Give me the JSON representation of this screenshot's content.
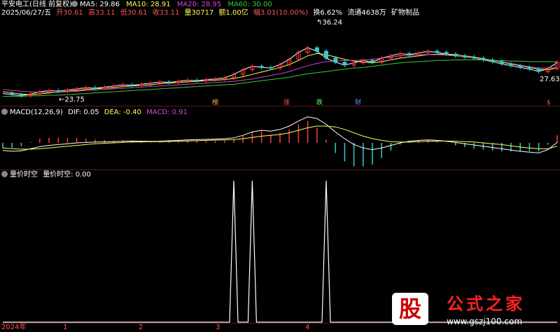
{
  "header": {
    "stock": "平安电工(日线 前复权)",
    "ma5_label": "MA5: 29.86",
    "ma10_label": "MA10: 28.91",
    "ma20_label": "MA20: 28.95",
    "ma60_label": "MA60: 30.00",
    "date": "2025/06/27/五",
    "open": "开30.61",
    "high": "高33.11",
    "low": "低30.61",
    "close": "收33.11",
    "volume": "量30717",
    "amount": "额1.00亿",
    "change": "幅3.01(10.00%)",
    "turnover": "换6.62%",
    "float": "流通4638万",
    "industry": "矿物制品"
  },
  "price_annotations": {
    "high": "36.24",
    "low": "23.75",
    "last": "27.63"
  },
  "event_tags": [
    "榜",
    "涨",
    "跌",
    "财",
    "$"
  ],
  "macd_header": {
    "name": "MACD(12,26,9)",
    "dif": "DIF: 0.05",
    "dea": "DEA: -0.40",
    "macd": "MACD: 0.91"
  },
  "indicator_header": {
    "name": "量价时空",
    "value": "量价时空: 0.00"
  },
  "timeline": [
    "2024年",
    "1",
    "2",
    "3",
    "4"
  ],
  "watermark": {
    "big": "股",
    "brand": "公式之家",
    "url": "www.gszj100.com"
  },
  "colors": {
    "up": "#ff3c3c",
    "down": "#33cccc",
    "ma5": "#ffffff",
    "ma10": "#ffff55",
    "ma20": "#cc44cc",
    "ma60": "#33cc33"
  },
  "chart_data": [
    {
      "type": "candlestick",
      "title": "平安电工(日线 前复权)",
      "series": [
        {
          "name": "MA5",
          "values": [
            24.5,
            24.3,
            24.1,
            24.4,
            24.8,
            25.0,
            24.9,
            25.1,
            25.3,
            25.5,
            25.4,
            25.6,
            25.8,
            26.0,
            25.9,
            26.1,
            26.3,
            26.5,
            26.4,
            26.6,
            26.8,
            26.7,
            26.9,
            27.0,
            27.2,
            27.8,
            28.6,
            29.2,
            29.0,
            28.9,
            29.5,
            30.4,
            31.6,
            32.4,
            31.8,
            30.6,
            29.9,
            29.4,
            29.8,
            30.2,
            29.9,
            30.6,
            31.0,
            31.4,
            31.2,
            31.5,
            31.8,
            31.6,
            31.3,
            31.0,
            30.8,
            30.6,
            30.3,
            30.0,
            29.6,
            29.3,
            29.0,
            28.7,
            28.3,
            28.8,
            29.86
          ]
        },
        {
          "name": "MA10",
          "values": [
            24.8,
            24.6,
            24.4,
            24.3,
            24.4,
            24.6,
            24.7,
            24.9,
            25.0,
            25.2,
            25.3,
            25.4,
            25.5,
            25.7,
            25.8,
            25.9,
            26.0,
            26.2,
            26.3,
            26.4,
            26.5,
            26.6,
            26.7,
            26.8,
            26.9,
            27.1,
            27.4,
            27.8,
            28.2,
            28.6,
            29.0,
            29.5,
            30.2,
            31.0,
            31.4,
            31.2,
            30.8,
            30.4,
            30.1,
            29.9,
            29.8,
            30.0,
            30.3,
            30.6,
            30.8,
            31.0,
            31.2,
            31.3,
            31.3,
            31.2,
            31.0,
            30.8,
            30.5,
            30.2,
            29.9,
            29.6,
            29.3,
            29.0,
            28.7,
            28.6,
            28.91
          ]
        },
        {
          "name": "MA20",
          "values": [
            25.2,
            25.0,
            24.9,
            24.8,
            24.7,
            24.7,
            24.7,
            24.8,
            24.9,
            25.0,
            25.1,
            25.2,
            25.3,
            25.4,
            25.5,
            25.6,
            25.7,
            25.8,
            25.9,
            26.0,
            26.1,
            26.2,
            26.3,
            26.4,
            26.5,
            26.6,
            26.8,
            27.0,
            27.3,
            27.6,
            27.9,
            28.3,
            28.8,
            29.3,
            29.7,
            30.0,
            30.1,
            30.2,
            30.2,
            30.3,
            30.4,
            30.6,
            30.8,
            31.0,
            31.1,
            31.2,
            31.2,
            31.2,
            31.1,
            31.0,
            30.8,
            30.6,
            30.4,
            30.2,
            30.0,
            29.7,
            29.4,
            29.1,
            28.9,
            28.9,
            28.95
          ]
        },
        {
          "name": "MA60",
          "values": [
            24.0,
            24.0,
            24.0,
            24.1,
            24.1,
            24.2,
            24.2,
            24.3,
            24.4,
            24.5,
            24.6,
            24.7,
            24.8,
            24.9,
            25.0,
            25.1,
            25.2,
            25.3,
            25.4,
            25.5,
            25.6,
            25.7,
            25.8,
            25.9,
            26.0,
            26.1,
            26.3,
            26.5,
            26.7,
            26.9,
            27.1,
            27.3,
            27.6,
            27.9,
            28.1,
            28.3,
            28.5,
            28.7,
            28.9,
            29.0,
            29.2,
            29.4,
            29.6,
            29.8,
            29.9,
            30.0,
            30.1,
            30.2,
            30.2,
            30.3,
            30.3,
            30.3,
            30.3,
            30.2,
            30.2,
            30.1,
            30.1,
            30.0,
            30.0,
            30.0,
            30.0
          ]
        }
      ],
      "annotations": {
        "high": 36.24,
        "low": 23.75,
        "last": 27.63
      },
      "ylim": [
        22.5,
        37.5
      ]
    },
    {
      "type": "bar",
      "title": "MACD(12,26,9)",
      "series": [
        {
          "name": "DIF",
          "values": [
            -0.9,
            -1.0,
            -0.95,
            -0.7,
            -0.45,
            -0.3,
            -0.2,
            -0.1,
            0.0,
            0.05,
            0.1,
            0.12,
            0.15,
            0.2,
            0.22,
            0.2,
            0.18,
            0.2,
            0.25,
            0.3,
            0.35,
            0.4,
            0.42,
            0.45,
            0.5,
            0.6,
            0.9,
            1.3,
            1.5,
            1.4,
            1.6,
            2.0,
            2.6,
            3.1,
            2.9,
            2.2,
            1.3,
            0.5,
            -0.2,
            -0.6,
            -0.8,
            -0.6,
            -0.3,
            0.0,
            0.2,
            0.3,
            0.35,
            0.3,
            0.2,
            0.05,
            -0.1,
            -0.25,
            -0.4,
            -0.55,
            -0.7,
            -0.85,
            -1.0,
            -1.1,
            -1.2,
            -0.8,
            0.05
          ]
        },
        {
          "name": "DEA",
          "values": [
            -0.6,
            -0.7,
            -0.75,
            -0.75,
            -0.7,
            -0.6,
            -0.5,
            -0.4,
            -0.3,
            -0.2,
            -0.1,
            -0.05,
            0.0,
            0.05,
            0.1,
            0.12,
            0.14,
            0.15,
            0.17,
            0.2,
            0.23,
            0.26,
            0.3,
            0.33,
            0.36,
            0.4,
            0.5,
            0.65,
            0.8,
            0.9,
            1.0,
            1.2,
            1.5,
            1.8,
            2.0,
            2.0,
            1.9,
            1.6,
            1.2,
            0.8,
            0.5,
            0.3,
            0.15,
            0.1,
            0.1,
            0.15,
            0.2,
            0.22,
            0.22,
            0.2,
            0.15,
            0.1,
            0.0,
            -0.1,
            -0.2,
            -0.35,
            -0.5,
            -0.6,
            -0.7,
            -0.7,
            -0.4
          ]
        }
      ]
    },
    {
      "type": "line",
      "title": "量价时空",
      "series": [
        {
          "name": "量价时空",
          "values": [
            0,
            0,
            0,
            0,
            0,
            0,
            0,
            0,
            0,
            0,
            0,
            0,
            0,
            0,
            0,
            0,
            0,
            0,
            0,
            0,
            0,
            0,
            0,
            0,
            0,
            1,
            0,
            1,
            0,
            0,
            0,
            0,
            0,
            0,
            0,
            1,
            0,
            0,
            0,
            0,
            0,
            0,
            0,
            0,
            0,
            0,
            0,
            0,
            0,
            0,
            0,
            0,
            0,
            0,
            0,
            0,
            0,
            0,
            0,
            0,
            0
          ]
        }
      ],
      "ylim": [
        0,
        1
      ]
    }
  ]
}
